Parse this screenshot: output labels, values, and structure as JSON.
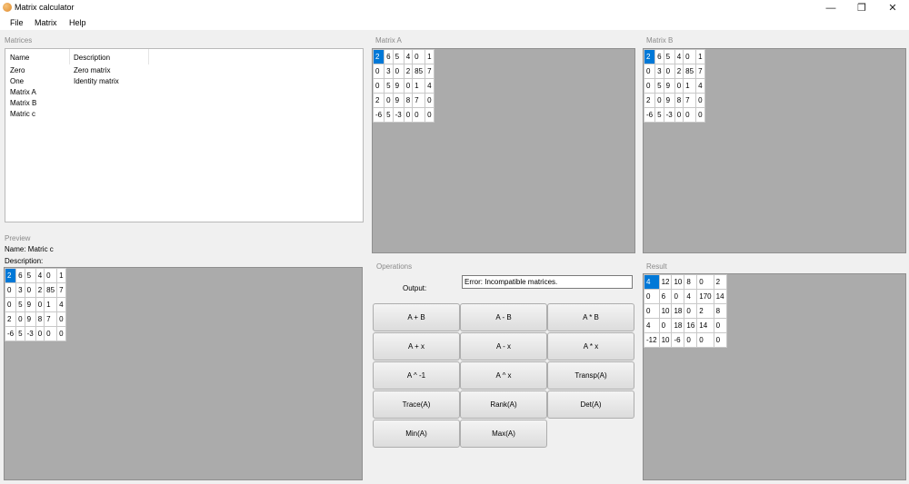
{
  "window": {
    "title": "Matrix calculator"
  },
  "menu": [
    "File",
    "Matrix",
    "Help"
  ],
  "matrices_panel": {
    "title": "Matrices",
    "headers": {
      "name": "Name",
      "description": "Description"
    },
    "rows": [
      {
        "name": "Zero",
        "description": "Zero matrix"
      },
      {
        "name": "One",
        "description": "Identity matrix"
      },
      {
        "name": "Matrix A",
        "description": ""
      },
      {
        "name": "Matrix B",
        "description": ""
      },
      {
        "name": "Matric c",
        "description": ""
      }
    ]
  },
  "preview": {
    "title": "Preview",
    "name_line": "Name: Matric c",
    "description_line": "Description:",
    "matrix": [
      [
        "2",
        "6",
        "5",
        "4",
        "0",
        "1"
      ],
      [
        "0",
        "3",
        "0",
        "2",
        "85",
        "7"
      ],
      [
        "0",
        "5",
        "9",
        "0",
        "1",
        "4"
      ],
      [
        "2",
        "0",
        "9",
        "8",
        "7",
        "0"
      ],
      [
        "-6",
        "5",
        "-3",
        "0",
        "0",
        "0"
      ]
    ]
  },
  "matrix_a": {
    "title": "Matrix A",
    "matrix": [
      [
        "2",
        "6",
        "5",
        "4",
        "0",
        "1"
      ],
      [
        "0",
        "3",
        "0",
        "2",
        "85",
        "7"
      ],
      [
        "0",
        "5",
        "9",
        "0",
        "1",
        "4"
      ],
      [
        "2",
        "0",
        "9",
        "8",
        "7",
        "0"
      ],
      [
        "-6",
        "5",
        "-3",
        "0",
        "0",
        "0"
      ]
    ]
  },
  "matrix_b": {
    "title": "Matrix B",
    "matrix": [
      [
        "2",
        "6",
        "5",
        "4",
        "0",
        "1"
      ],
      [
        "0",
        "3",
        "0",
        "2",
        "85",
        "7"
      ],
      [
        "0",
        "5",
        "9",
        "0",
        "1",
        "4"
      ],
      [
        "2",
        "0",
        "9",
        "8",
        "7",
        "0"
      ],
      [
        "-6",
        "5",
        "-3",
        "0",
        "0",
        "0"
      ]
    ]
  },
  "operations": {
    "title": "Operations",
    "output_label": "Output:",
    "output_value": "Error: Incompatible matrices.",
    "buttons": [
      "A + B",
      "A - B",
      "A * B",
      "A + x",
      "A - x",
      "A * x",
      "A ^ -1",
      "A ^ x",
      "Transp(A)",
      "Trace(A)",
      "Rank(A)",
      "Det(A)",
      "Min(A)",
      "Max(A)"
    ]
  },
  "result": {
    "title": "Result",
    "matrix": [
      [
        "4",
        "12",
        "10",
        "8",
        "0",
        "2"
      ],
      [
        "0",
        "6",
        "0",
        "4",
        "170",
        "14"
      ],
      [
        "0",
        "10",
        "18",
        "0",
        "2",
        "8"
      ],
      [
        "4",
        "0",
        "18",
        "16",
        "14",
        "0"
      ],
      [
        "-12",
        "10",
        "-6",
        "0",
        "0",
        "0"
      ]
    ]
  },
  "colors": {
    "selection": "#0078d7",
    "grid_background": "#ababab",
    "panel": "#f0f0f0"
  }
}
